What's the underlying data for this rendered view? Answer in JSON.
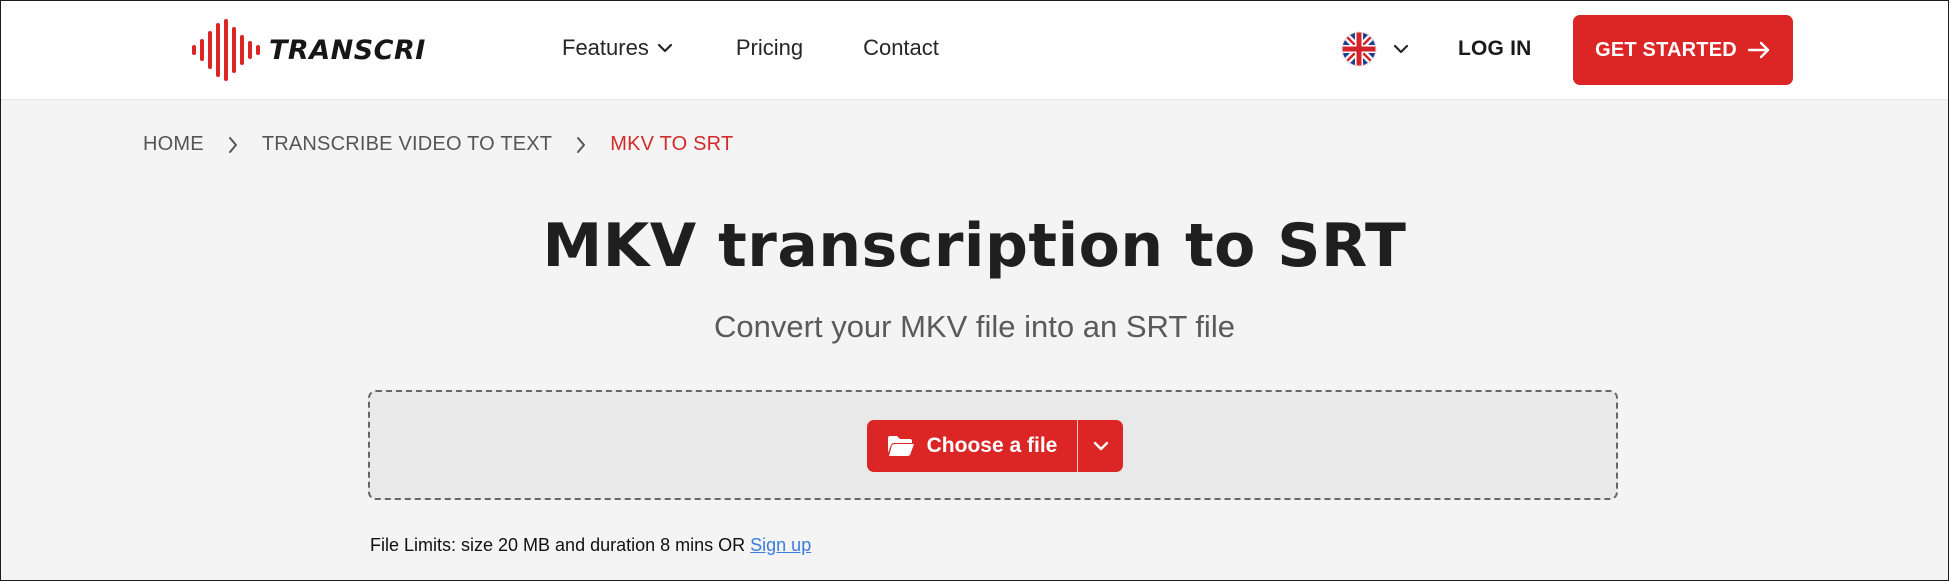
{
  "header": {
    "logo_text": "TRANSCRI",
    "nav": {
      "features": "Features",
      "pricing": "Pricing",
      "contact": "Contact"
    },
    "language_flag": "uk-flag-icon",
    "login": "LOG IN",
    "cta": "GET STARTED"
  },
  "breadcrumb": {
    "items": [
      "HOME",
      "TRANSCRIBE VIDEO TO TEXT",
      "MKV TO SRT"
    ]
  },
  "main": {
    "title": "MKV transcription to SRT",
    "subtitle": "Convert your MKV file into an SRT file",
    "choose_button": "Choose a file",
    "limits_text": "File Limits: size 20 MB and duration 8 mins OR ",
    "signup_link": "Sign up"
  },
  "colors": {
    "brand_red": "#dc2626",
    "breadcrumb_active": "#d22b2b",
    "link_blue": "#3b7ddd",
    "page_background": "#f4f4f4"
  }
}
